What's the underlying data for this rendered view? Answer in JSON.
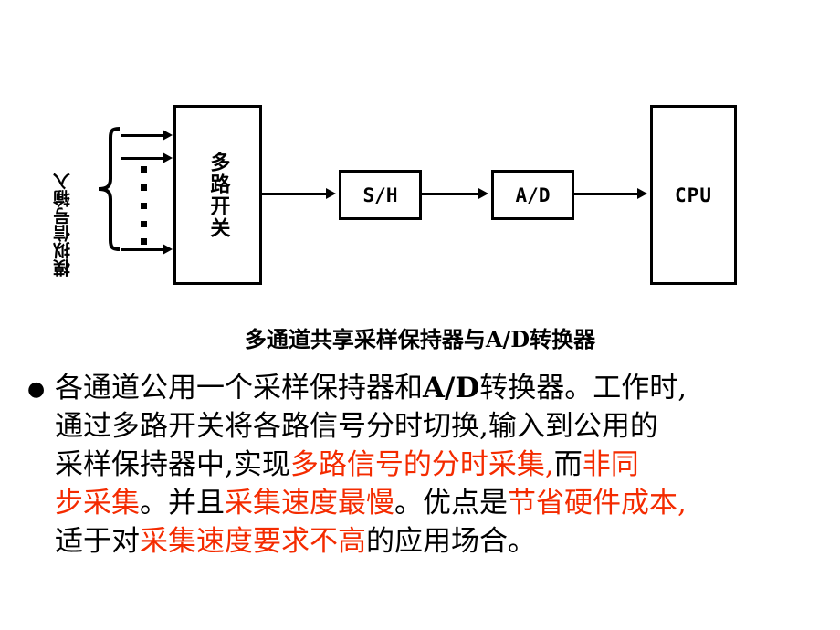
{
  "slide": {
    "background_color": "#FFFFFF",
    "text_color": "#000000",
    "highlight_color": "#F42B00"
  },
  "diagram": {
    "input_label": "模拟信号输入",
    "blocks": [
      {
        "id": "mux",
        "label": "多路开关",
        "orientation": "vertical"
      },
      {
        "id": "sample_hold",
        "label": "S/H",
        "orientation": "horizontal"
      },
      {
        "id": "adc",
        "label": "A/D",
        "orientation": "horizontal"
      },
      {
        "id": "cpu",
        "label": "CPU",
        "orientation": "horizontal"
      }
    ],
    "input_arrow_count": 3,
    "ellipsis_dot_count": 5
  },
  "caption": {
    "text": "多通道共享采样保持器与A/D转换器"
  },
  "body": {
    "bullet": "●",
    "lines": [
      {
        "segments": [
          {
            "text": "各通道公用一个采样保持器和",
            "highlight": false
          },
          {
            "text": "A/D",
            "highlight": false,
            "bold": true
          },
          {
            "text": "转换器。工作时,",
            "highlight": false
          }
        ]
      },
      {
        "segments": [
          {
            "text": "通过多路开关将各路信号分时切换,输入到公用的",
            "highlight": false
          }
        ]
      },
      {
        "segments": [
          {
            "text": "采样保持器中,实现",
            "highlight": false
          },
          {
            "text": "多路信号的分时采集,",
            "highlight": true
          },
          {
            "text": "而",
            "highlight": false
          },
          {
            "text": "非同",
            "highlight": true
          }
        ]
      },
      {
        "segments": [
          {
            "text": "步采集",
            "highlight": true
          },
          {
            "text": "。并且",
            "highlight": false
          },
          {
            "text": "采集速度最慢",
            "highlight": true
          },
          {
            "text": "。优点是",
            "highlight": false
          },
          {
            "text": "节省硬件成本,",
            "highlight": true
          }
        ]
      },
      {
        "segments": [
          {
            "text": "适于对",
            "highlight": false
          },
          {
            "text": "采集速度要求不高",
            "highlight": true
          },
          {
            "text": "的应用场合。",
            "highlight": false
          }
        ]
      }
    ]
  }
}
